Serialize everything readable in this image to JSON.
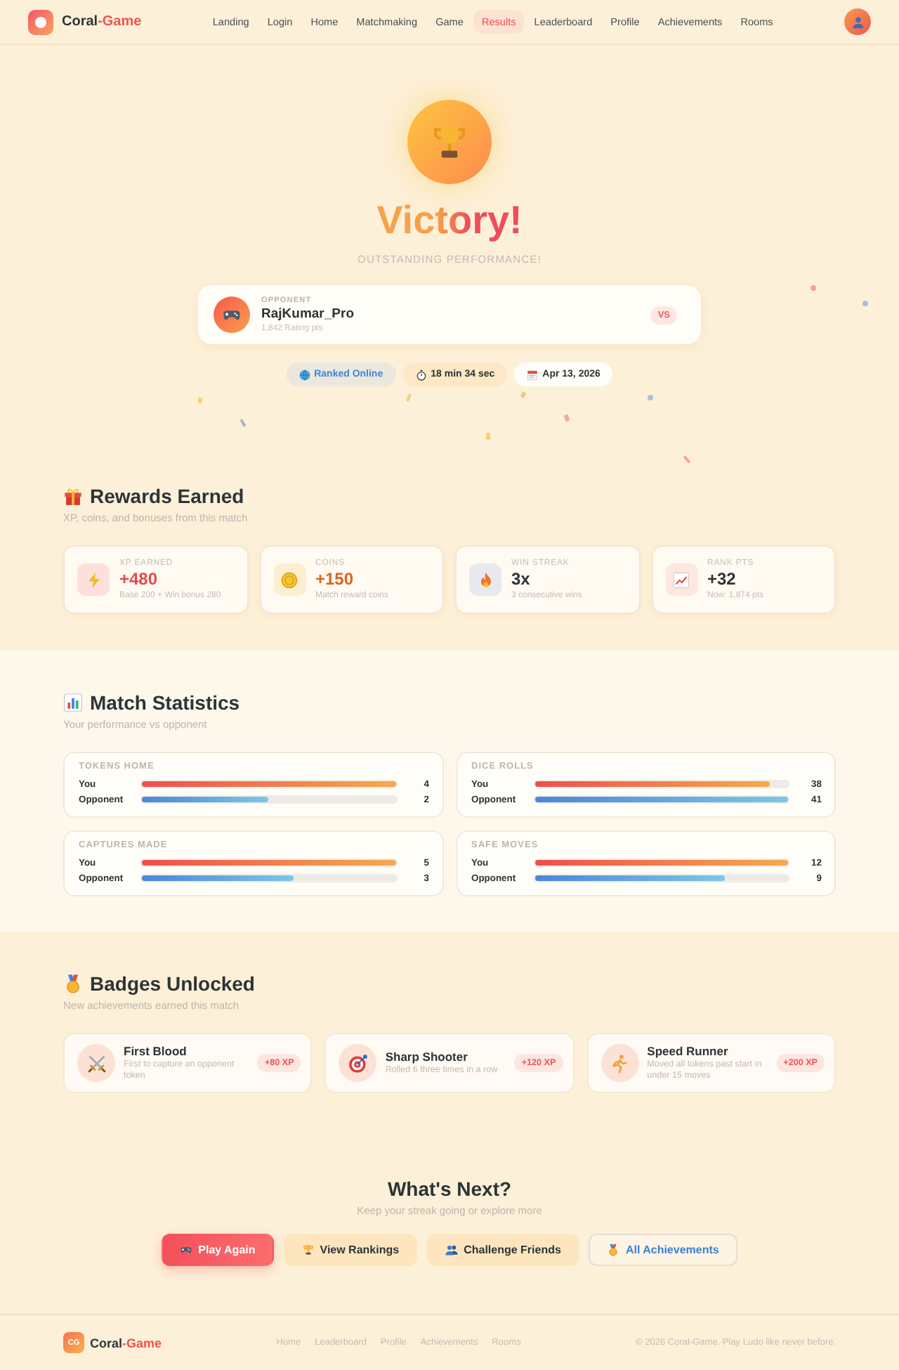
{
  "header": {
    "brand": {
      "name": "Coral",
      "accent": "-Game"
    },
    "nav": [
      {
        "label": "Landing",
        "selected": false
      },
      {
        "label": "Login",
        "selected": false
      },
      {
        "label": "Home",
        "selected": false
      },
      {
        "label": "Matchmaking",
        "selected": false
      },
      {
        "label": "Game",
        "selected": false
      },
      {
        "label": "Results",
        "selected": true
      },
      {
        "label": "Leaderboard",
        "selected": false
      },
      {
        "label": "Profile",
        "selected": false
      },
      {
        "label": "Achievements",
        "selected": false
      },
      {
        "label": "Rooms",
        "selected": false
      }
    ]
  },
  "hero": {
    "title": "Victory!",
    "subtitle": "OUTSTANDING PERFORMANCE!",
    "opponent": {
      "label": "OPPONENT",
      "name": "RajKumar_Pro",
      "rating": "1,842 Rating pts",
      "badge": "VS"
    },
    "chips": [
      {
        "kind": "mode",
        "label": "Ranked Online"
      },
      {
        "kind": "duration",
        "label": "18 min 34 sec"
      },
      {
        "kind": "date",
        "label": "Apr 13, 2026"
      }
    ]
  },
  "rewards": {
    "title": "Rewards Earned",
    "subtitle": "XP, coins, and bonuses from this match",
    "cards": [
      {
        "kind": "xp",
        "label": "XP EARNED",
        "value": "+480",
        "detail": "Base 200 + Win bonus 280"
      },
      {
        "kind": "coins",
        "label": "COINS",
        "value": "+150",
        "detail": "Match reward coins"
      },
      {
        "kind": "streak",
        "label": "WIN STREAK",
        "value": "3x",
        "detail": "3 consecutive wins"
      },
      {
        "kind": "rank",
        "label": "RANK PTS",
        "value": "+32",
        "detail": "Now: 1,874 pts"
      }
    ]
  },
  "statistics": {
    "title": "Match Statistics",
    "subtitle": "Your performance vs opponent",
    "cards": [
      {
        "title": "TOKENS HOME",
        "rows": [
          {
            "kind": "you",
            "label": "You",
            "level": 1,
            "value": "4"
          },
          {
            "kind": "opponent",
            "label": "Opponent",
            "level": 0.5,
            "value": "2"
          }
        ]
      },
      {
        "title": "DICE ROLLS",
        "rows": [
          {
            "kind": "you",
            "label": "You",
            "level": 0.93,
            "value": "38"
          },
          {
            "kind": "opponent",
            "label": "Opponent",
            "level": 1,
            "value": "41"
          }
        ]
      },
      {
        "title": "CAPTURES MADE",
        "rows": [
          {
            "kind": "you",
            "label": "You",
            "level": 1,
            "value": "5"
          },
          {
            "kind": "opponent",
            "label": "Opponent",
            "level": 0.6,
            "value": "3"
          }
        ]
      },
      {
        "title": "SAFE MOVES",
        "rows": [
          {
            "kind": "you",
            "label": "You",
            "level": 1,
            "value": "12"
          },
          {
            "kind": "opponent",
            "label": "Opponent",
            "level": 0.75,
            "value": "9"
          }
        ]
      }
    ]
  },
  "badges": {
    "title": "Badges Unlocked",
    "subtitle": "New achievements earned this match",
    "items": [
      {
        "kind": "capture",
        "title": "First Blood",
        "description": "First to capture an opponent token",
        "xp": "+80 XP"
      },
      {
        "kind": "dice",
        "title": "Sharp Shooter",
        "description": "Rolled 6 three times in a row",
        "xp": "+120 XP"
      },
      {
        "kind": "speed",
        "title": "Speed Runner",
        "description": "Moved all tokens past start in under 15 moves",
        "xp": "+200 XP"
      }
    ]
  },
  "next": {
    "title": "What's Next?",
    "subtitle": "Keep your streak going or explore more",
    "actions": [
      {
        "kind": "play",
        "label": "Play Again"
      },
      {
        "kind": "rankings",
        "label": "View Rankings"
      },
      {
        "kind": "challenge",
        "label": "Challenge Friends"
      },
      {
        "kind": "achievements",
        "label": "All Achievements"
      }
    ]
  },
  "footer": {
    "brand": {
      "mark": "CG",
      "name": "Coral",
      "accent": "-Game"
    },
    "links": [
      "Home",
      "Leaderboard",
      "Profile",
      "Achievements",
      "Rooms"
    ],
    "copyright": "© 2026 Coral-Game. Play Ludo like never before."
  }
}
